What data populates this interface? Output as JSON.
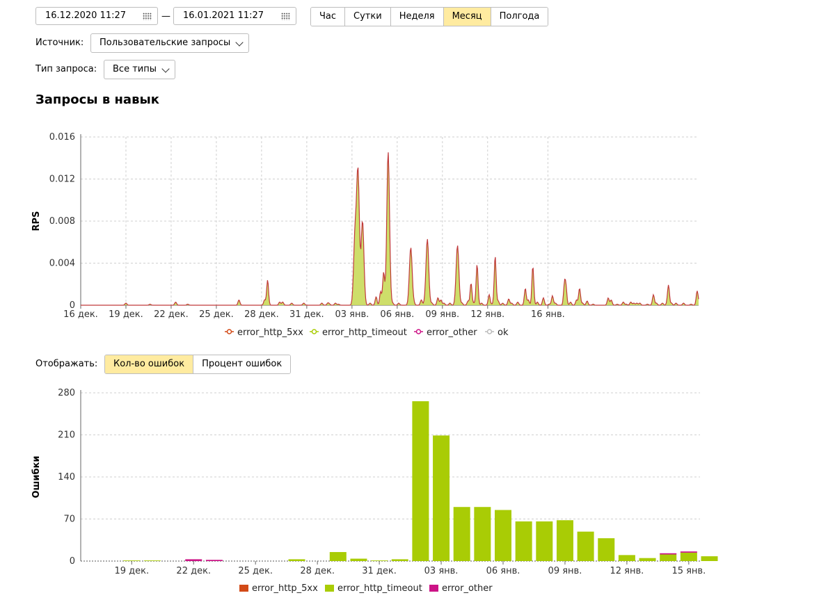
{
  "date_range": {
    "from": "16.12.2020 11:27",
    "separator": "—",
    "to": "16.01.2021 11:27"
  },
  "period_buttons": [
    {
      "label": "Час",
      "active": false
    },
    {
      "label": "Сутки",
      "active": false
    },
    {
      "label": "Неделя",
      "active": false
    },
    {
      "label": "Месяц",
      "active": true
    },
    {
      "label": "Полгода",
      "active": false
    }
  ],
  "source": {
    "label": "Источник:",
    "value": "Пользовательские запросы"
  },
  "request_type": {
    "label": "Тип запроса:",
    "value": "Все типы"
  },
  "section_title": "Запросы в навык",
  "display": {
    "label": "Отображать:",
    "options": [
      {
        "label": "Кол-во ошибок",
        "active": true
      },
      {
        "label": "Процент ошибок",
        "active": false
      }
    ]
  },
  "colors": {
    "error_http_5xx": "#d24a17",
    "error_http_timeout": "#a9cc05",
    "error_other": "#cc1386",
    "ok": "#bbbbbb",
    "active_btn": "#ffeba0"
  },
  "chart_data": [
    {
      "type": "area",
      "ylabel": "RPS",
      "ylim": [
        0,
        0.016
      ],
      "y_ticks": [
        "0",
        "0.004",
        "0.008",
        "0.012",
        "0.016"
      ],
      "x_ticks": [
        "16 дек.",
        "19 дек.",
        "22 дек.",
        "25 дек.",
        "28 дек.",
        "31 дек.",
        "03 янв.",
        "06 янв.",
        "09 янв.",
        "12 янв.",
        "16 янв."
      ],
      "grid": true,
      "legend": "bottom",
      "series": [
        {
          "name": "error_http_5xx"
        },
        {
          "name": "error_http_timeout"
        },
        {
          "name": "error_other"
        },
        {
          "name": "ok"
        }
      ],
      "peaks_days_from_start": [
        [
          3.0,
          0.0002
        ],
        [
          4.6,
          0.0001
        ],
        [
          6.3,
          0.0003
        ],
        [
          7.1,
          0.0001
        ],
        [
          10.5,
          0.0005
        ],
        [
          12.2,
          0.0005
        ],
        [
          12.4,
          0.0024
        ],
        [
          13.2,
          0.0003
        ],
        [
          13.4,
          0.0003
        ],
        [
          14.0,
          0.0002
        ],
        [
          14.8,
          0.0002
        ],
        [
          16.0,
          0.0002
        ],
        [
          16.4,
          0.0002
        ],
        [
          16.5,
          0.0001
        ],
        [
          16.9,
          0.0002
        ],
        [
          17.1,
          0.0001
        ],
        [
          18.2,
          0.0066
        ],
        [
          18.4,
          0.0125
        ],
        [
          18.7,
          0.008
        ],
        [
          19.2,
          0.0002
        ],
        [
          19.6,
          0.0008
        ],
        [
          19.9,
          0.0013
        ],
        [
          20.1,
          0.0031
        ],
        [
          20.4,
          0.0146
        ],
        [
          20.7,
          0.0002
        ],
        [
          21.1,
          0.0002
        ],
        [
          21.9,
          0.0055
        ],
        [
          22.1,
          0.0002
        ],
        [
          22.6,
          0.0005
        ],
        [
          22.8,
          0.0001
        ],
        [
          23.0,
          0.0063
        ],
        [
          23.3,
          0.0002
        ],
        [
          23.7,
          0.0007
        ],
        [
          23.9,
          0.0005
        ],
        [
          24.1,
          0.0002
        ],
        [
          24.5,
          0.0002
        ],
        [
          25.0,
          0.0057
        ],
        [
          25.3,
          0.0002
        ],
        [
          25.7,
          0.0004
        ],
        [
          25.9,
          0.0021
        ],
        [
          26.1,
          0.0002
        ],
        [
          26.3,
          0.0039
        ],
        [
          26.6,
          0.0002
        ],
        [
          27.1,
          0.001
        ],
        [
          27.3,
          0.0001
        ],
        [
          27.5,
          0.0047
        ],
        [
          27.7,
          0.0004
        ],
        [
          28.0,
          0.0002
        ],
        [
          28.4,
          0.0006
        ],
        [
          28.6,
          0.0002
        ],
        [
          29.0,
          0.0003
        ],
        [
          29.5,
          0.0016
        ],
        [
          29.7,
          0.0005
        ],
        [
          30.0,
          0.0037
        ],
        [
          30.3,
          0.0003
        ],
        [
          30.7,
          0.0007
        ],
        [
          31.1,
          0.0001
        ],
        [
          31.3,
          0.0009
        ],
        [
          31.5,
          0.0002
        ],
        [
          32.1,
          0.0019
        ],
        [
          32.2,
          0.0015
        ],
        [
          32.5,
          0.0003
        ],
        [
          32.9,
          0.0005
        ],
        [
          33.1,
          0.0016
        ],
        [
          33.3,
          0.0002
        ],
        [
          33.6,
          0.0004
        ],
        [
          34.0,
          0.0001
        ],
        [
          35.0,
          0.0007
        ],
        [
          35.2,
          0.0005
        ],
        [
          35.6,
          0.0001
        ],
        [
          36.0,
          0.0003
        ],
        [
          36.2,
          0.0001
        ],
        [
          36.5,
          0.0003
        ],
        [
          36.7,
          0.0002
        ],
        [
          36.9,
          0.0002
        ],
        [
          37.1,
          0.0002
        ],
        [
          37.6,
          0.0001
        ],
        [
          38.0,
          0.001
        ],
        [
          38.2,
          0.0002
        ],
        [
          38.6,
          0.0002
        ],
        [
          38.9,
          0.0001
        ],
        [
          39.0,
          0.0019
        ],
        [
          39.2,
          0.0002
        ],
        [
          39.5,
          0.0002
        ],
        [
          40.0,
          0.0002
        ],
        [
          40.5,
          0.0001
        ],
        [
          40.9,
          0.0013
        ],
        [
          41.0,
          0.0002
        ],
        [
          41.4,
          0.0003
        ]
      ]
    },
    {
      "type": "bar",
      "ylabel": "Ошибки",
      "ylim": [
        0,
        280
      ],
      "y_ticks": [
        "0",
        "70",
        "140",
        "210",
        "280"
      ],
      "x_ticks": [
        "19 дек.",
        "22 дек.",
        "25 дек.",
        "28 дек.",
        "31 дек.",
        "03 янв.",
        "06 янв.",
        "09 янв.",
        "12 янв.",
        "15 янв."
      ],
      "legend": "bottom",
      "series": [
        {
          "name": "error_http_5xx",
          "values": [
            0,
            0,
            0,
            0,
            0,
            0,
            0,
            0,
            0,
            0,
            0,
            0,
            0,
            0,
            0,
            0,
            0,
            0,
            0,
            0,
            0,
            0,
            0,
            0,
            0,
            0,
            0,
            0,
            0,
            0,
            0
          ]
        },
        {
          "name": "error_http_timeout",
          "values": [
            0,
            0,
            1,
            1,
            0,
            0,
            0,
            0,
            0,
            0,
            3,
            0,
            15,
            4,
            1,
            3,
            266,
            209,
            90,
            90,
            85,
            66,
            66,
            68,
            49,
            38,
            10,
            5,
            11,
            14,
            8
          ]
        },
        {
          "name": "error_other",
          "values": [
            0,
            0,
            0,
            0,
            0,
            3,
            2,
            0,
            0,
            0,
            0,
            0,
            0,
            0,
            0,
            0,
            0,
            0,
            0,
            0,
            0,
            0,
            0,
            0,
            0,
            0,
            0,
            0,
            2,
            2,
            0
          ]
        }
      ]
    }
  ]
}
